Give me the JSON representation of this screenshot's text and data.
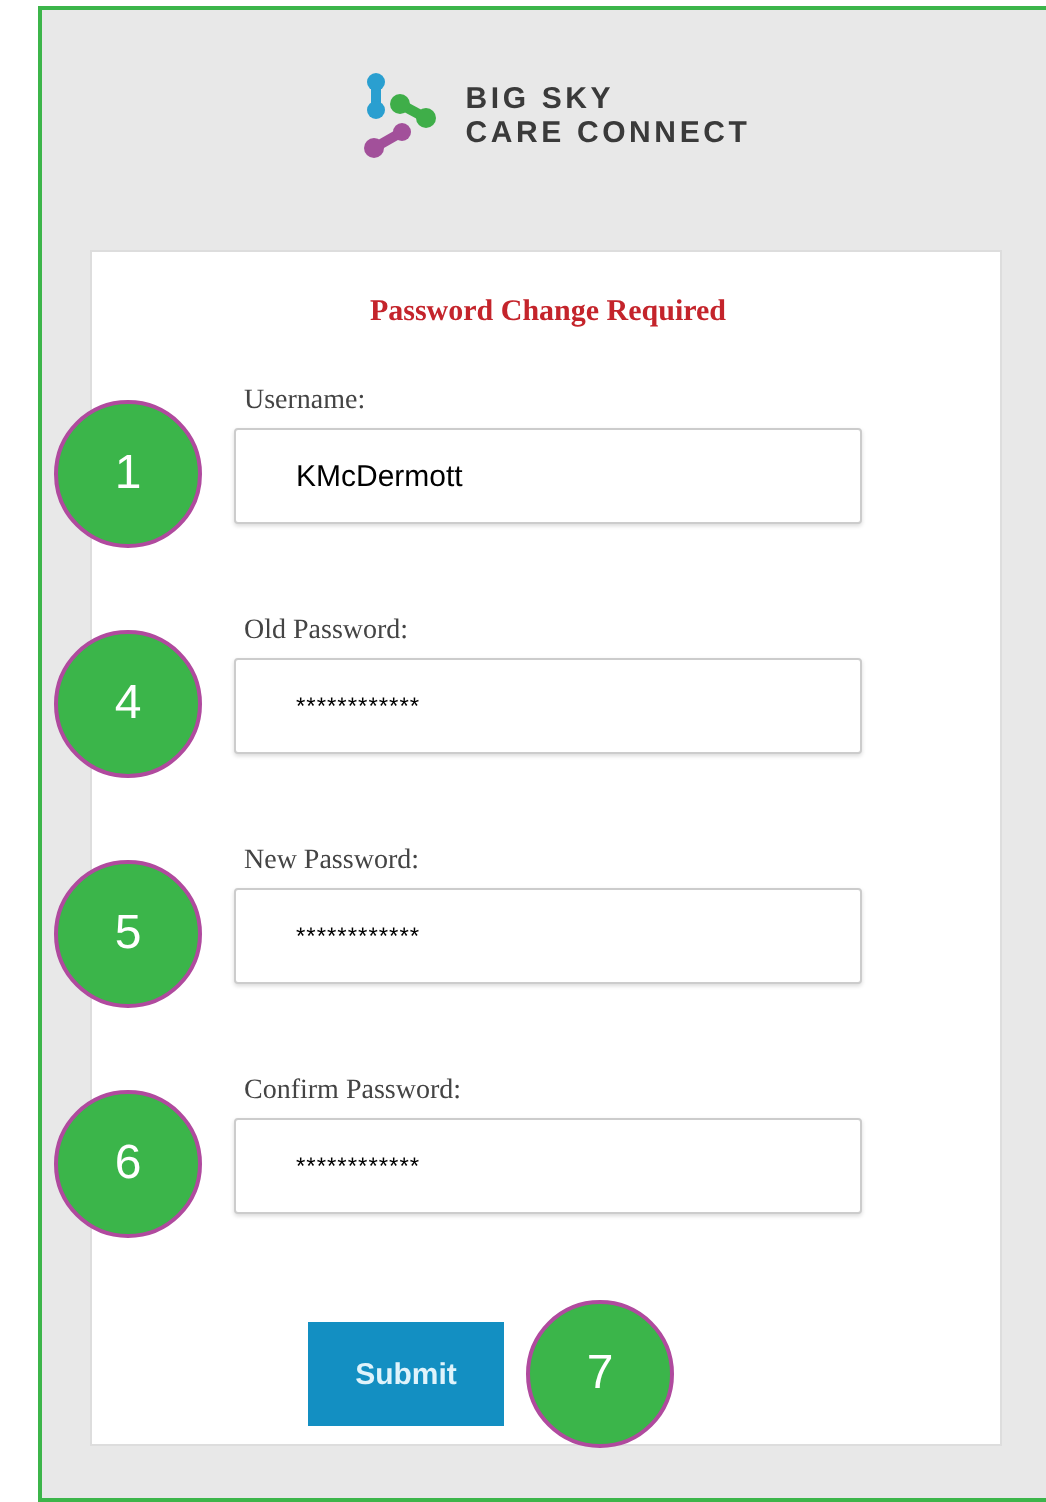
{
  "logo": {
    "lines": [
      "BIG SKY",
      "CARE CONNECT"
    ]
  },
  "form": {
    "title": "Password Change Required",
    "fields": [
      {
        "label": "Username:",
        "value": "KMcDermott",
        "kind": "text",
        "badge": "1"
      },
      {
        "label": "Old Password:",
        "value": "************",
        "kind": "password",
        "badge": "4"
      },
      {
        "label": "New Password:",
        "value": "************",
        "kind": "password",
        "badge": "5"
      },
      {
        "label": "Confirm Password:",
        "value": "************",
        "kind": "password",
        "badge": "6"
      }
    ],
    "submit": {
      "label": "Submit",
      "badge": "7"
    }
  }
}
